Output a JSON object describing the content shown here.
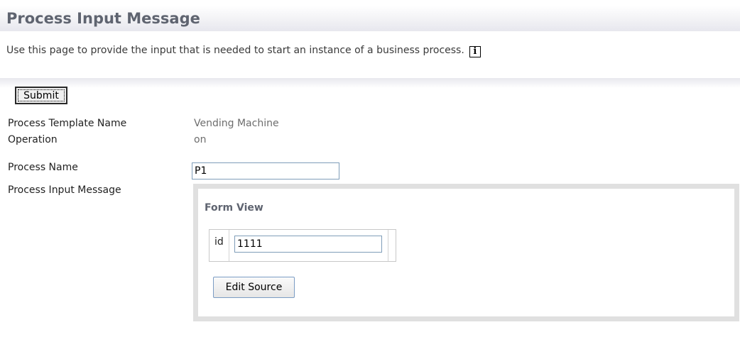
{
  "header": {
    "title": "Process Input Message",
    "description": "Use this page to provide the input that is needed to start an instance of a business process.",
    "info_icon": "info-icon"
  },
  "toolbar": {
    "submit_label": "Submit"
  },
  "fields": {
    "template_label": "Process Template Name",
    "template_value": "Vending Machine",
    "operation_label": "Operation",
    "operation_value": "on",
    "process_name_label": "Process Name",
    "process_name_value": "P1",
    "input_message_label": "Process Input Message"
  },
  "form_view": {
    "heading": "Form View",
    "field_label": "id",
    "field_value": "1111",
    "edit_source_label": "Edit Source"
  },
  "colors": {
    "title_text": "#5f6470",
    "value_text": "#6d6d6d",
    "panel_border": "#e0e0e0",
    "input_border": "#7f9db9"
  }
}
